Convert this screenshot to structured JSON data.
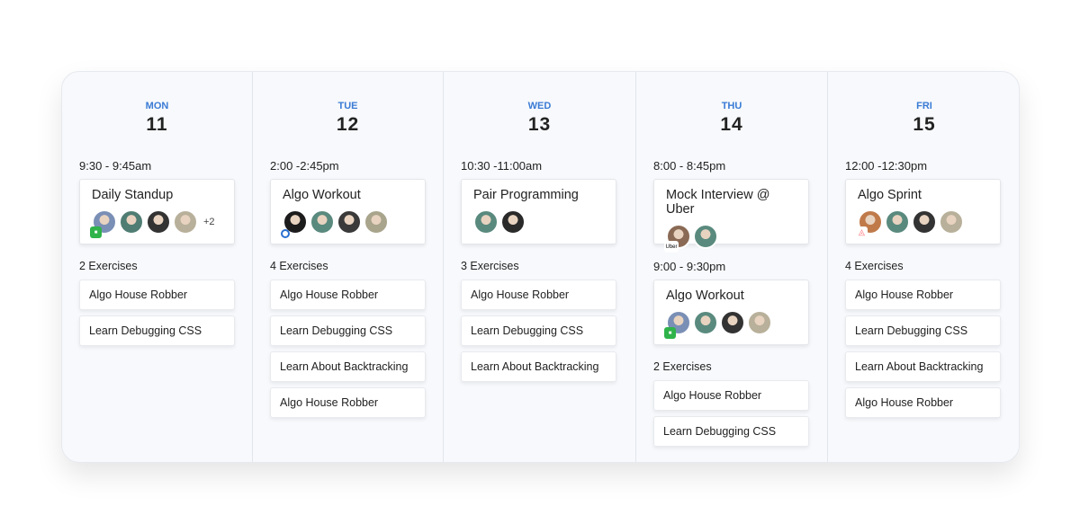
{
  "colors": {
    "accent": "#3a7bd5",
    "background": "#f7f9fc"
  },
  "days": [
    {
      "dow": "MON",
      "num": "11",
      "blocks": [
        {
          "time": "9:30 - 9:45am",
          "title": "Daily Standup",
          "badge": "green-square-icon",
          "avatars": [
            "#7a8fb5",
            "#4f7d73",
            "#333333",
            "#b8b09a"
          ],
          "more": "+2"
        }
      ],
      "exercises_label": "2 Exercises",
      "exercises": [
        "Algo House Robber",
        "Learn Debugging CSS"
      ]
    },
    {
      "dow": "TUE",
      "num": "12",
      "blocks": [
        {
          "time": "2:00 -2:45pm",
          "title": "Algo Workout",
          "badge": "blue-target-icon",
          "avatars": [
            "#1c1c1c",
            "#5a8a7e",
            "#3a3a3a",
            "#a9a48c"
          ]
        }
      ],
      "exercises_label": "4 Exercises",
      "exercises": [
        "Algo House Robber",
        "Learn Debugging CSS",
        "Learn About Backtracking",
        "Algo House Robber"
      ]
    },
    {
      "dow": "WED",
      "num": "13",
      "blocks": [
        {
          "time": "10:30 -11:00am",
          "title": "Pair Programming",
          "avatars": [
            "#5a8a7e",
            "#2a2a2a"
          ]
        }
      ],
      "exercises_label": "3 Exercises",
      "exercises": [
        "Algo House Robber",
        "Learn Debugging CSS",
        "Learn About Backtracking"
      ]
    },
    {
      "dow": "THU",
      "num": "14",
      "blocks": [
        {
          "time": "8:00 - 8:45pm",
          "title": "Mock Interview @ Uber",
          "badge": "uber-logo-icon",
          "badge_text": "Uber",
          "avatars": [
            "#8a6a55",
            "#5a8a7e"
          ]
        },
        {
          "time": "9:00 - 9:30pm",
          "title": "Algo Workout",
          "badge": "green-square-icon",
          "avatars": [
            "#7a8fb5",
            "#5a8a7e",
            "#333333",
            "#b8b09a"
          ]
        }
      ],
      "exercises_label": "2 Exercises",
      "exercises": [
        "Algo House Robber",
        "Learn Debugging CSS"
      ]
    },
    {
      "dow": "FRI",
      "num": "15",
      "blocks": [
        {
          "time": "12:00 -12:30pm",
          "title": "Algo Sprint",
          "badge": "airbnb-logo-icon",
          "avatars": [
            "#c07a4a",
            "#5a8a7e",
            "#333333",
            "#b8b09a"
          ]
        }
      ],
      "exercises_label": "4 Exercises",
      "exercises": [
        "Algo House Robber",
        "Learn Debugging CSS",
        "Learn About Backtracking",
        "Algo House Robber"
      ]
    }
  ]
}
